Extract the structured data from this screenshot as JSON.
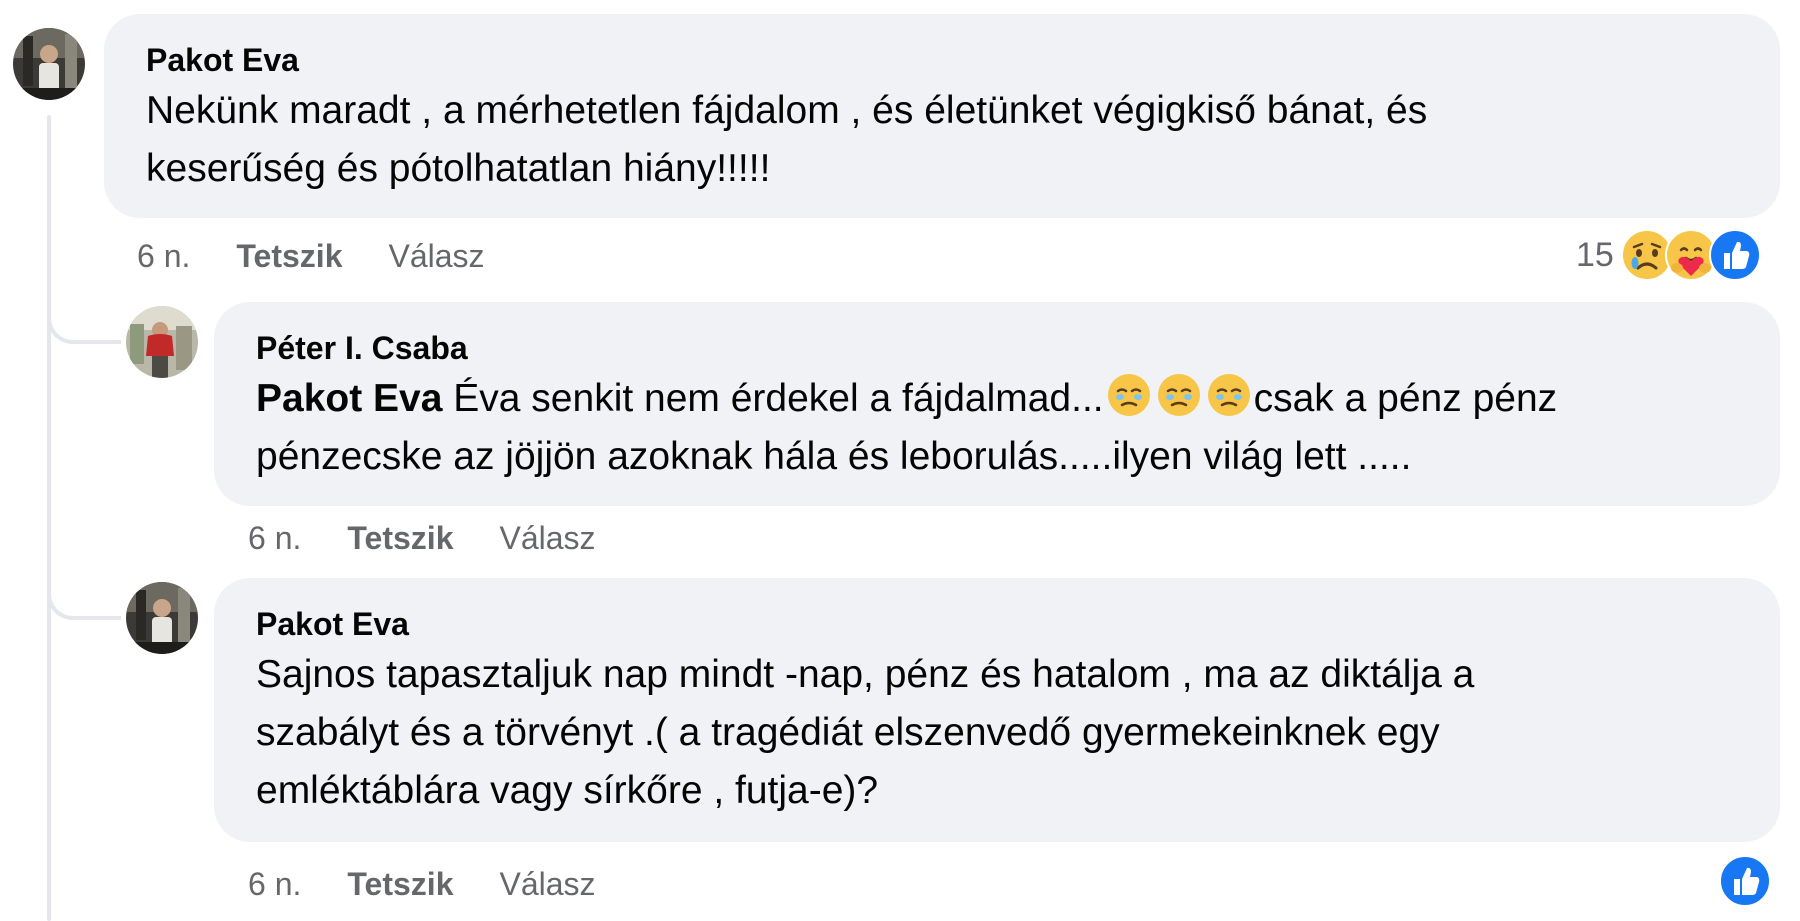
{
  "comments": [
    {
      "author": "Pakot Eva",
      "text": "Nekünk maradt , a mérhetetlen fájdalom , és életünket végigkiső bánat, és\nkeserűség és pótolhatatlan hiány!!!!!",
      "time": "6 n.",
      "like_label": "Tetszik",
      "reply_label": "Válasz",
      "reaction_count": "15",
      "reaction_icons": [
        "sad-icon",
        "care-icon",
        "like-icon"
      ]
    },
    {
      "author": "Péter I. Csaba",
      "mention": "Pakot Eva",
      "text_part1": " Éva senkit nem érdekel a fájdalmad...",
      "text_part2": "csak a pénz pénz\npénzecske az jöjjön azoknak hála és leborulás.....ilyen világ lett .....",
      "inline_emoji": "face-holding-back-tears-icon",
      "time": "6 n.",
      "like_label": "Tetszik",
      "reply_label": "Válasz"
    },
    {
      "author": "Pakot Eva",
      "text": "Sajnos tapasztaljuk nap mindt -nap, pénz és hatalom , ma az diktálja a\nszabályt és a törvényt .( a tragédiát elszenvedő gyermekeinknek egy\nemléktáblára vagy sírkőre , futja-e)?",
      "time": "6 n.",
      "like_label": "Tetszik",
      "reply_label": "Válasz",
      "reaction_icons": [
        "like-icon"
      ]
    }
  ],
  "colors": {
    "bubble": "#f0f2f5",
    "meta": "#65676b",
    "like_blue": "#1877f2",
    "thread_line": "#e4e6eb"
  }
}
